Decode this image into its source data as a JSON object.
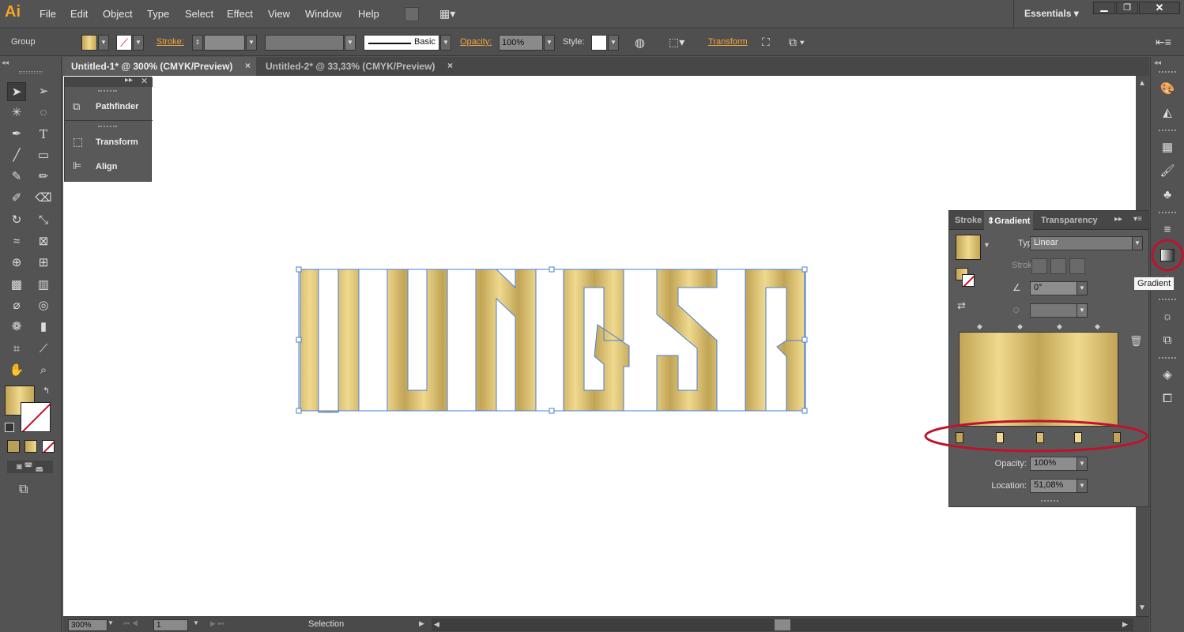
{
  "app": {
    "logo": "Ai"
  },
  "menu": [
    "File",
    "Edit",
    "Object",
    "Type",
    "Select",
    "Effect",
    "View",
    "Window",
    "Help"
  ],
  "workspace": {
    "label": "Essentials"
  },
  "control_bar": {
    "selection_label": "Group",
    "stroke_label": "Stroke:",
    "brush_label": "Basic",
    "opacity_label": "Opacity:",
    "opacity_value": "100%",
    "style_label": "Style:",
    "transform_label": "Transform"
  },
  "tabs": [
    {
      "label": "Untitled-1* @ 300% (CMYK/Preview)",
      "active": true
    },
    {
      "label": "Untitled-2* @ 33,33% (CMYK/Preview)",
      "active": false
    }
  ],
  "float_panel": {
    "items": [
      "Pathfinder",
      "Transform",
      "Align"
    ]
  },
  "artwork": {
    "text": "JUNGSR"
  },
  "gradient_panel": {
    "tabs": [
      "Stroke",
      "Gradient",
      "Transparency"
    ],
    "type_label": "Type:",
    "type_value": "Linear",
    "stroke_label": "Stroke:",
    "angle_value": "0°",
    "opacity_label": "Opacity:",
    "opacity_value": "100%",
    "location_label": "Location:",
    "location_value": "51,08%"
  },
  "tooltip": {
    "text": "Gradient"
  },
  "status_bar": {
    "zoom": "300%",
    "page": "1",
    "tool": "Selection"
  },
  "colors": {
    "accent": "#f0a640",
    "highlight_circle": "#c0122b",
    "selection": "#4a7fd4",
    "gold_light": "#efd98e",
    "gold_dark": "#c2a455"
  }
}
